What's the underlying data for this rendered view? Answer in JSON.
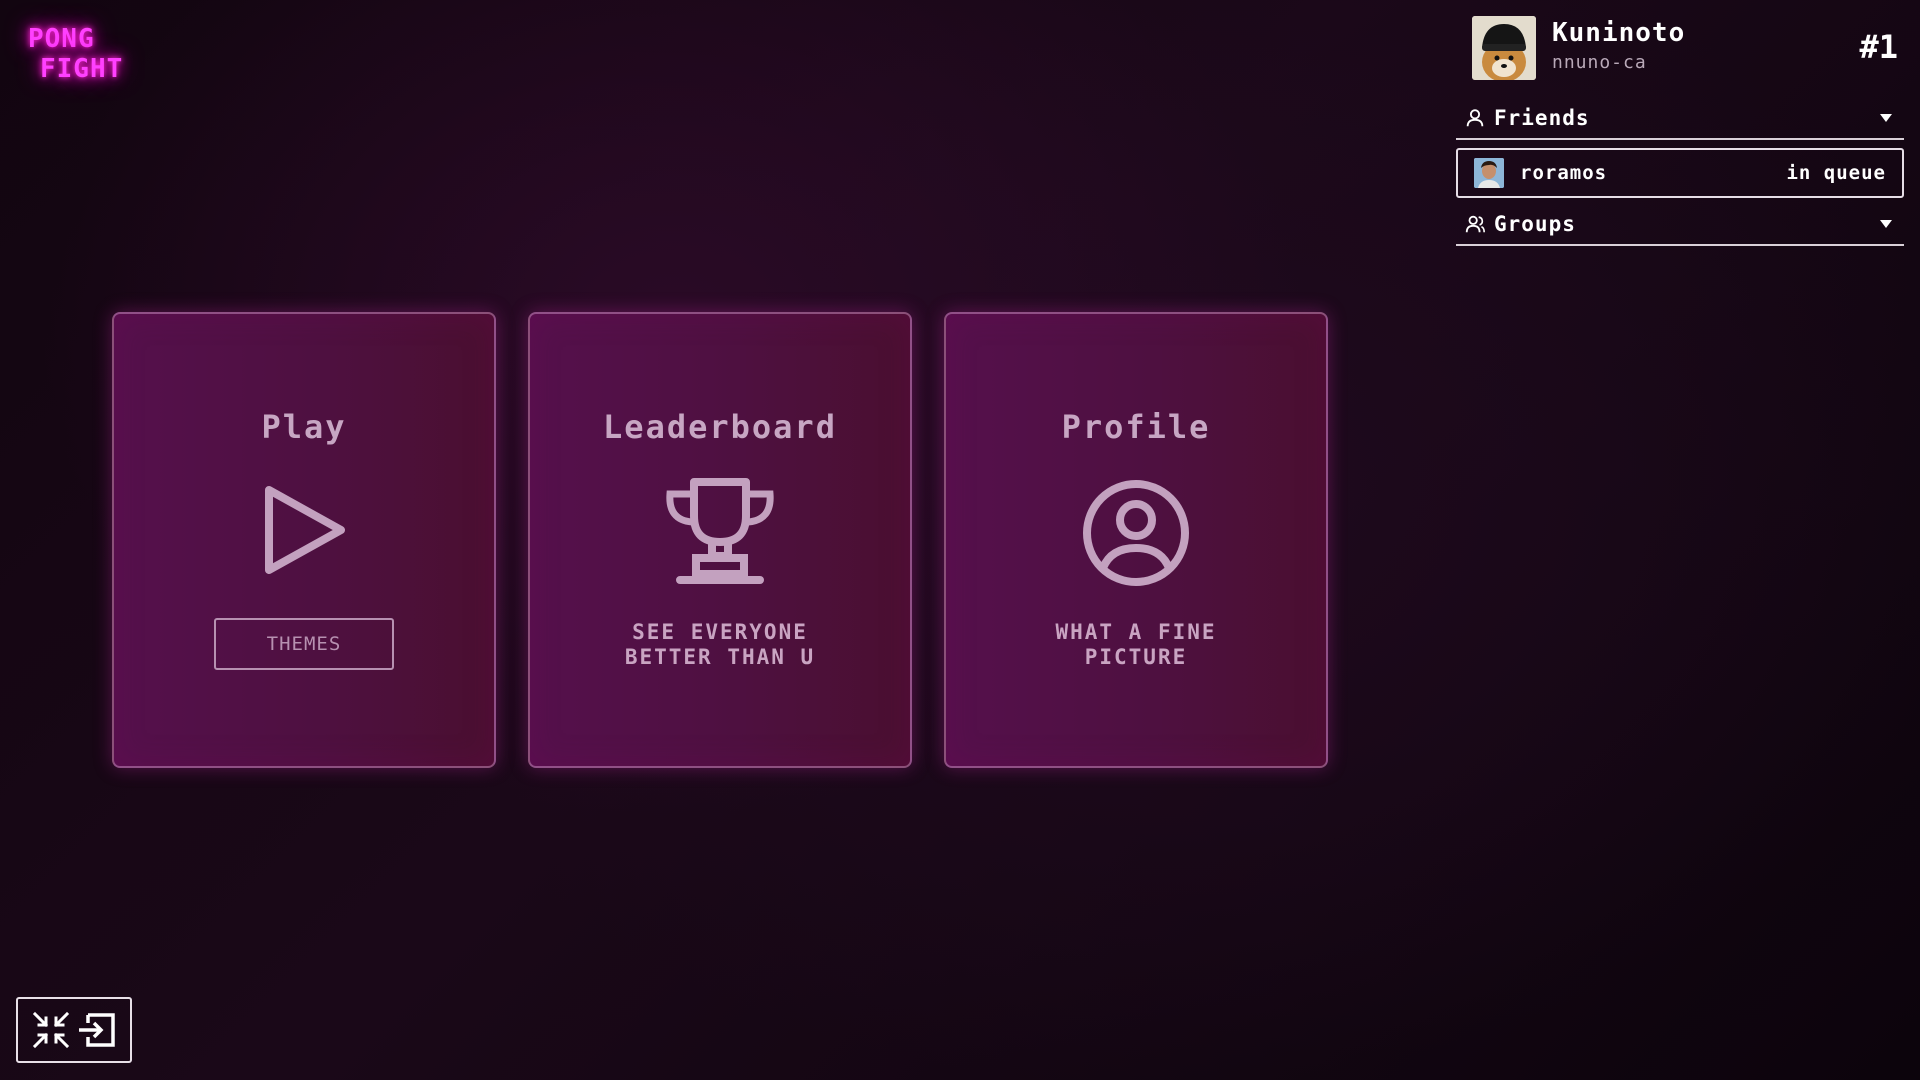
{
  "logo": {
    "line1": "PONG",
    "line2": "FIGHT",
    "color": "#ff40ff"
  },
  "user": {
    "display_name": "Kuninoto",
    "login": "nnuno-ca",
    "rank": "#1",
    "avatar_icon": "user-avatar"
  },
  "sidebar": {
    "friends": {
      "label": "Friends",
      "icon": "user-icon",
      "items": [
        {
          "name": "roramos",
          "status": "in queue",
          "avatar_icon": "friend-avatar"
        }
      ]
    },
    "groups": {
      "label": "Groups",
      "icon": "users-icon"
    }
  },
  "cards": [
    {
      "title": "Play",
      "icon": "play-icon",
      "button_label": "THEMES"
    },
    {
      "title": "Leaderboard",
      "icon": "trophy-icon",
      "description": "SEE EVERYONE\nBETTER THAN U"
    },
    {
      "title": "Profile",
      "icon": "user-circle-icon",
      "description": "WHAT A FINE\nPICTURE"
    }
  ],
  "controls": {
    "icons": [
      "minimize-icon",
      "logout-icon"
    ]
  },
  "colors": {
    "background": "#0d040d",
    "card": "#55104c",
    "card_text": "#c9a4c2",
    "accent": "#ff40ff"
  }
}
